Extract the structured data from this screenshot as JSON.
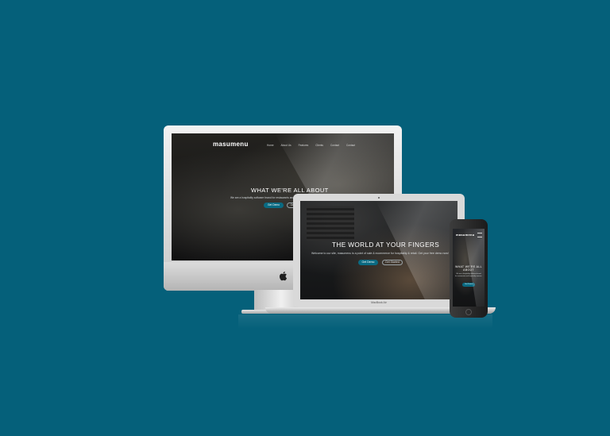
{
  "colors": {
    "background": "#05607a",
    "accent": "#0a6a82"
  },
  "site": {
    "logo": "masumenu",
    "nav": [
      "Home",
      "About Us",
      "Features",
      "Clients",
      "Contact",
      "Contact"
    ]
  },
  "imac": {
    "hero_title": "WHAT WE'RE ALL ABOUT",
    "hero_sub": "We are a hospitality software brand for restaurants and hospitality venues.",
    "primary_button": "Get Demo",
    "secondary_button": "Get Started"
  },
  "macbook": {
    "hero_title": "THE WORLD AT YOUR FINGERS",
    "hero_sub": "Welcome to our site, masumenu is a point of sale & ecommerce for hospitality & retail. Get your free demo now!",
    "primary_button": "Get Demo",
    "secondary_button": "Get Started",
    "label": "MacBook Air"
  },
  "iphone": {
    "logo": "masumenu",
    "hero_title": "WHAT WE'RE ALL ABOUT",
    "hero_sub": "We are a hospitality software brand for restaurants and hospitality venues.",
    "primary_button": "Get Demo"
  },
  "icons": {
    "apple": "apple-logo-icon"
  }
}
